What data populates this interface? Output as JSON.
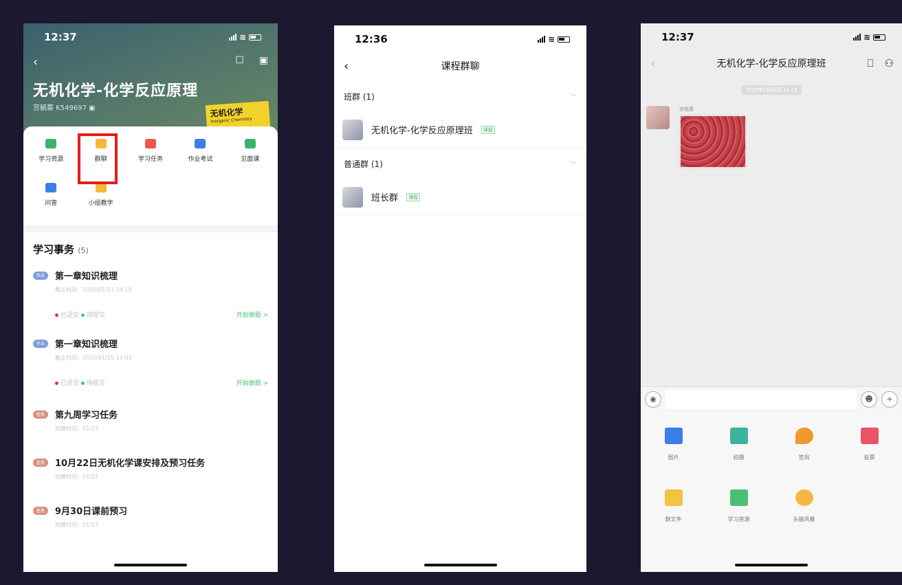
{
  "phone1": {
    "time": "12:37",
    "course_title": "无机化学-化学反应原理",
    "course_meta": "宫毓蓁  K549697  ▣",
    "book_title": "无机化学",
    "book_subtitle": "Inorganic Chemistry",
    "tools": [
      {
        "label": "学习资源",
        "color": "#3bb36b"
      },
      {
        "label": "群聊",
        "color": "#f2b93a"
      },
      {
        "label": "学习任务",
        "color": "#ea5a4a"
      },
      {
        "label": "作业考试",
        "color": "#3a7ee6"
      },
      {
        "label": "见面课",
        "color": "#3bb36b"
      },
      {
        "label": "问答",
        "color": "#3a7ee6"
      },
      {
        "label": "小组教学",
        "color": "#f2b93a"
      }
    ],
    "section_title": "学习事务",
    "section_count": "(5)",
    "tasks": [
      {
        "tag": "作业",
        "title": "第一章知识梳理",
        "sub": "截止时间：2020/01/17 14:18",
        "submitted": "已迟交",
        "pending": "待提交",
        "action": "开始做题 >"
      },
      {
        "tag": "作业",
        "title": "第一章知识梳理",
        "sub": "截止时间：2020/01/15 11:03",
        "submitted": "已迟交",
        "pending": "待提交",
        "action": "开始做题 >"
      },
      {
        "tag": "任务",
        "title": "第九周学习任务",
        "sub": "创建时间：01/15"
      },
      {
        "tag": "任务",
        "title": "10月22日无机化学课安排及预习任务",
        "sub": "创建时间：01/15"
      },
      {
        "tag": "任务",
        "title": "9月30日课前预习",
        "sub": "创建时间：01/15"
      }
    ]
  },
  "phone2": {
    "time": "12:36",
    "nav_title": "课程群聊",
    "groups": [
      {
        "header": "班群 (1)",
        "name": "无机化学-化学反应原理班",
        "tag": "课程"
      },
      {
        "header": "普通群 (1)",
        "name": "班长群",
        "tag": "课程"
      }
    ]
  },
  "phone3": {
    "time": "12:37",
    "nav_title": "无机化学-化学反应原理班",
    "date_chip": "2020年1月19日 14:19",
    "sender": "宫毓蓁",
    "extras": [
      {
        "label": "图片",
        "color": "#3a7ee6"
      },
      {
        "label": "拍摄",
        "color": "#3bb3a0"
      },
      {
        "label": "签到",
        "color": "#f0982b"
      },
      {
        "label": "投票",
        "color": "#e95464"
      },
      {
        "label": "群文件",
        "color": "#f5c342"
      },
      {
        "label": "学习资源",
        "color": "#4cbf73"
      },
      {
        "label": "头脑风暴",
        "color": "#f5b942"
      }
    ]
  }
}
